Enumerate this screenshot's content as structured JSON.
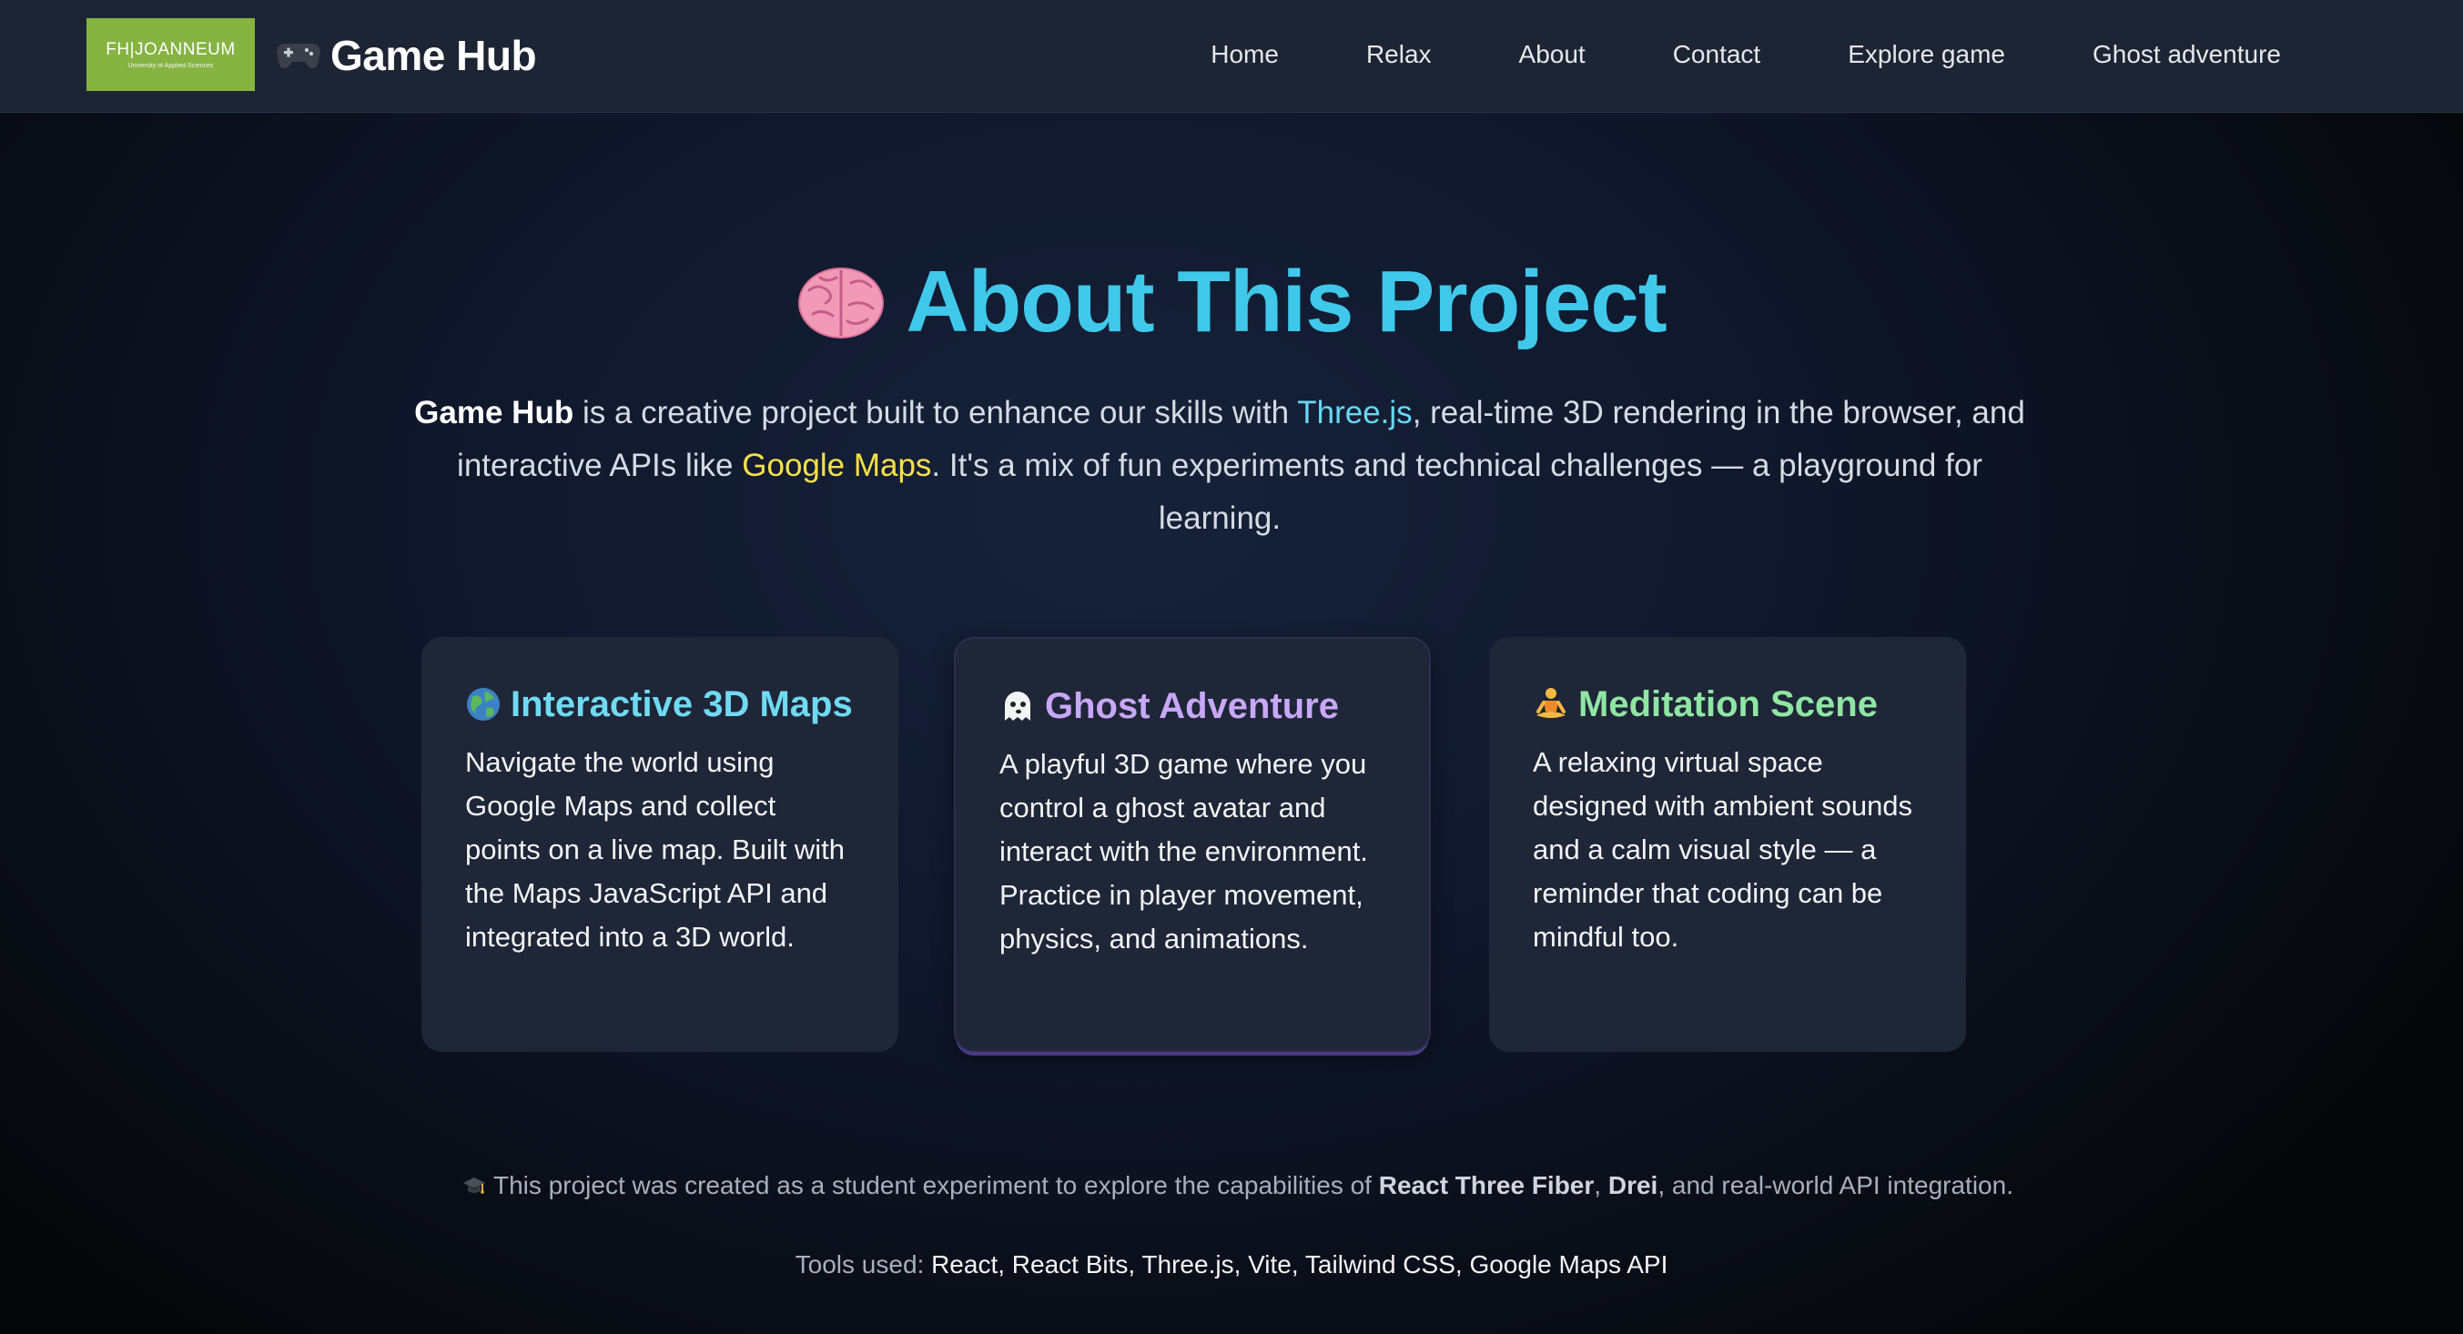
{
  "header": {
    "logo": {
      "main": "FH|JOANNEUM",
      "sub": "University of Applied Sciences"
    },
    "brand_name": "Game Hub",
    "nav": [
      "Home",
      "Relax",
      "About",
      "Contact",
      "Explore game",
      "Ghost adventure"
    ]
  },
  "hero": {
    "title": "About This Project",
    "intro": {
      "brand": "Game Hub",
      "part1": " is a creative project built to enhance our skills with ",
      "threejs": "Three.js",
      "part2": ", real-time 3D rendering in the browser, and interactive APIs like ",
      "gmaps": "Google Maps",
      "part3": ". It's a mix of fun experiments and technical challenges — a playground for learning."
    }
  },
  "cards": [
    {
      "icon": "globe-icon",
      "title": "Interactive 3D Maps",
      "body": "Navigate the world using Google Maps and collect points on a live map. Built with the Maps JavaScript API and integrated into a 3D world."
    },
    {
      "icon": "ghost-icon",
      "title": "Ghost Adventure",
      "body": "A playful 3D game where you control a ghost avatar and interact with the environment. Practice in player movement, physics, and animations."
    },
    {
      "icon": "meditation-icon",
      "title": "Meditation Scene",
      "body": "A relaxing virtual space designed with ambient sounds and a calm visual style — a reminder that coding can be mindful too."
    }
  ],
  "footer": {
    "line1_a": "This project was created as a student experiment to explore the capabilities of ",
    "r3f": "React Three Fiber",
    "sep": ", ",
    "drei": "Drei",
    "line1_b": ", and real-world API integration.",
    "tools_label": "Tools used: ",
    "tools": "React, React Bits, Three.js, Vite, Tailwind CSS, Google Maps API"
  },
  "colors": {
    "accent": "#3fc8ea",
    "logo_green": "#86b342",
    "card_bg": "#1e2637",
    "header_bg": "#1d2534"
  }
}
